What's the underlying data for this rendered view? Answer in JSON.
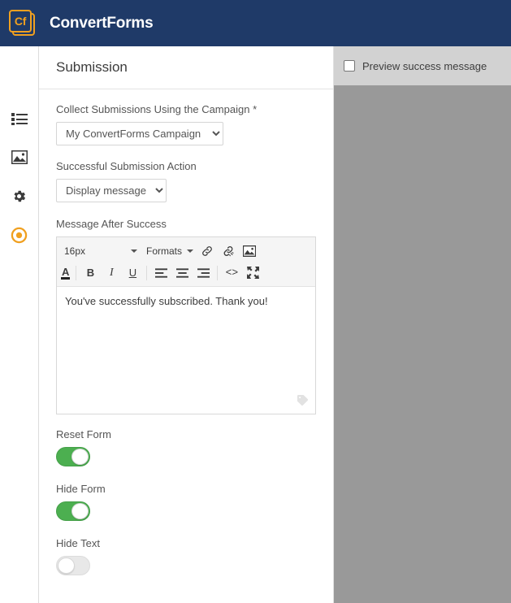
{
  "header": {
    "logo_glyph": "Cf",
    "logo_icon": "convertforms-logo-icon",
    "brand": "ConvertForms"
  },
  "sidebar": {
    "items": [
      {
        "icon": "list-icon",
        "name": "forms-list"
      },
      {
        "icon": "image-icon",
        "name": "media"
      },
      {
        "icon": "gear-icon",
        "name": "settings"
      },
      {
        "icon": "target-circle-icon",
        "name": "submission",
        "active": true
      }
    ],
    "active_color": "#f0a020"
  },
  "panel": {
    "title": "Submission",
    "campaign_field": {
      "label": "Collect Submissions Using the Campaign",
      "required_mark": "*",
      "value": "My ConvertForms Campaign",
      "options": [
        "My ConvertForms Campaign"
      ]
    },
    "action_field": {
      "label": "Successful Submission Action",
      "value": "Display message",
      "options": [
        "Display message"
      ]
    },
    "message_field": {
      "label": "Message After Success",
      "content": "You've successfully subscribed. Thank you!",
      "toolbar": {
        "font_size": "16px",
        "formats": "Formats",
        "buttons_row1": [
          {
            "name": "link-icon",
            "glyph": "link"
          },
          {
            "name": "unlink-icon",
            "glyph": "unlink"
          },
          {
            "name": "image-icon",
            "glyph": "image"
          }
        ],
        "buttons_row2": [
          {
            "name": "text-color-icon",
            "glyph": "A"
          },
          {
            "name": "bold-icon",
            "glyph": "B"
          },
          {
            "name": "italic-icon",
            "glyph": "I"
          },
          {
            "name": "underline-icon",
            "glyph": "U"
          },
          {
            "name": "align-left-icon",
            "glyph": "align-left"
          },
          {
            "name": "align-center-icon",
            "glyph": "align-center"
          },
          {
            "name": "align-right-icon",
            "glyph": "align-right"
          },
          {
            "name": "source-code-icon",
            "glyph": "<>"
          },
          {
            "name": "fullscreen-icon",
            "glyph": "fullscreen"
          }
        ]
      }
    },
    "toggles": [
      {
        "label": "Reset Form",
        "state": "on"
      },
      {
        "label": "Hide Form",
        "state": "on"
      },
      {
        "label": "Hide Text",
        "state": "off"
      }
    ]
  },
  "preview": {
    "checkbox_label": "Preview success message",
    "checkbox_checked": false
  },
  "colors": {
    "header_bg": "#1f3a68",
    "accent_orange": "#f0a020",
    "toggle_green": "#4caf50",
    "preview_bg": "#999999",
    "preview_strip_bg": "#d2d2d2"
  }
}
